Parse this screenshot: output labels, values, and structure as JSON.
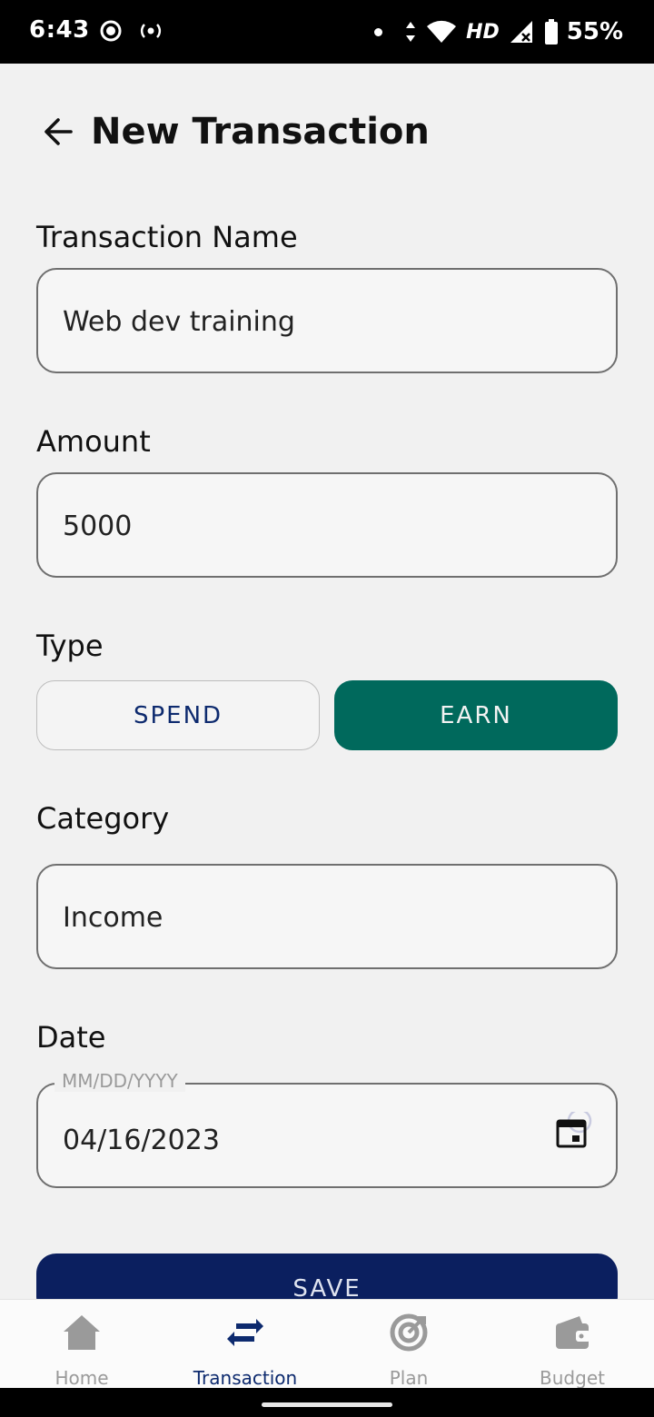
{
  "status_bar": {
    "time": "6:43",
    "network": "HD",
    "battery": "55%"
  },
  "header": {
    "title": "New Transaction"
  },
  "form": {
    "name": {
      "label": "Transaction Name",
      "value": "Web dev training"
    },
    "amount": {
      "label": "Amount",
      "value": "5000"
    },
    "type": {
      "label": "Type",
      "spend_label": "SPEND",
      "earn_label": "EARN",
      "selected": "EARN"
    },
    "category": {
      "label": "Category",
      "value": "Income"
    },
    "date": {
      "label": "Date",
      "placeholder": "MM/DD/YYYY",
      "value": "04/16/2023"
    },
    "save_label": "SAVE"
  },
  "bottom_nav": {
    "items": [
      {
        "label": "Home",
        "icon": "home-icon"
      },
      {
        "label": "Transaction",
        "icon": "swap-icon",
        "active": true
      },
      {
        "label": "Plan",
        "icon": "target-icon"
      },
      {
        "label": "Budget",
        "icon": "wallet-icon"
      }
    ]
  },
  "colors": {
    "accent_navy": "#0b1f5f",
    "earn_green": "#00695c",
    "background": "#f1f1f1",
    "inactive_gray": "#9a9a9a"
  }
}
